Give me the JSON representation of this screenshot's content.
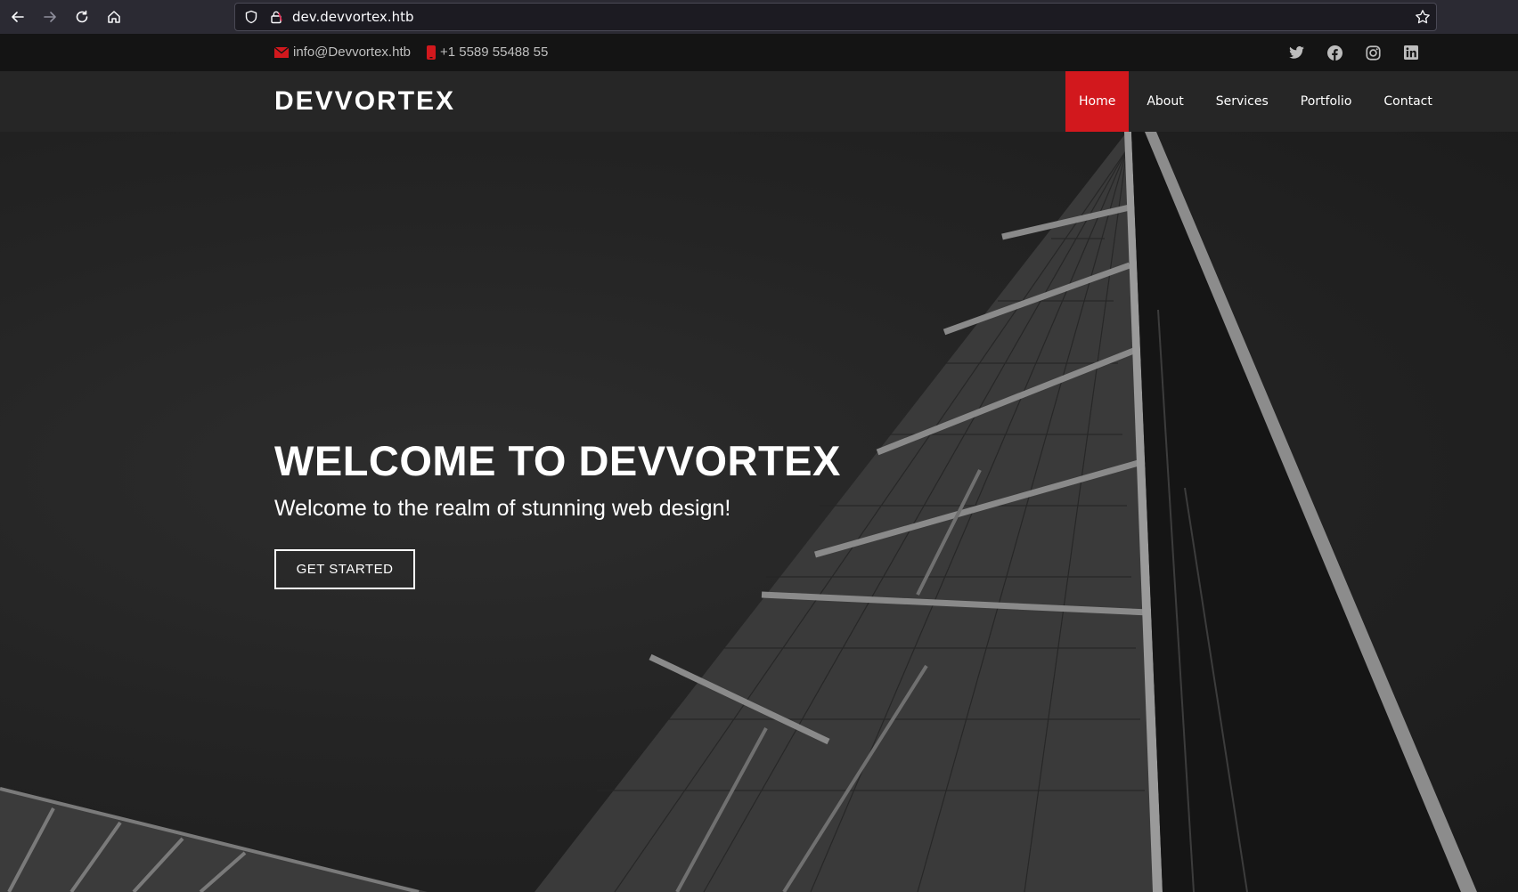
{
  "browser": {
    "url": "dev.devvortex.htb"
  },
  "topbar": {
    "email": "info@Devvortex.htb",
    "phone": "+1 5589 55488 55",
    "socials": [
      "twitter-icon",
      "facebook-icon",
      "instagram-icon",
      "linkedin-icon"
    ]
  },
  "header": {
    "logo": "DEVVORTEX",
    "menu": [
      "Home",
      "About",
      "Services",
      "Portfolio",
      "Contact"
    ],
    "active_item": "Home"
  },
  "hero": {
    "title": "WELCOME TO DEVVORTEX",
    "subtitle": "Welcome to the realm of stunning web design!",
    "cta_label": "GET STARTED"
  },
  "colors": {
    "accent": "#d2181d",
    "topbar_bg": "#141414",
    "header_bg": "#262626",
    "chrome_bg": "#2b2a33"
  }
}
